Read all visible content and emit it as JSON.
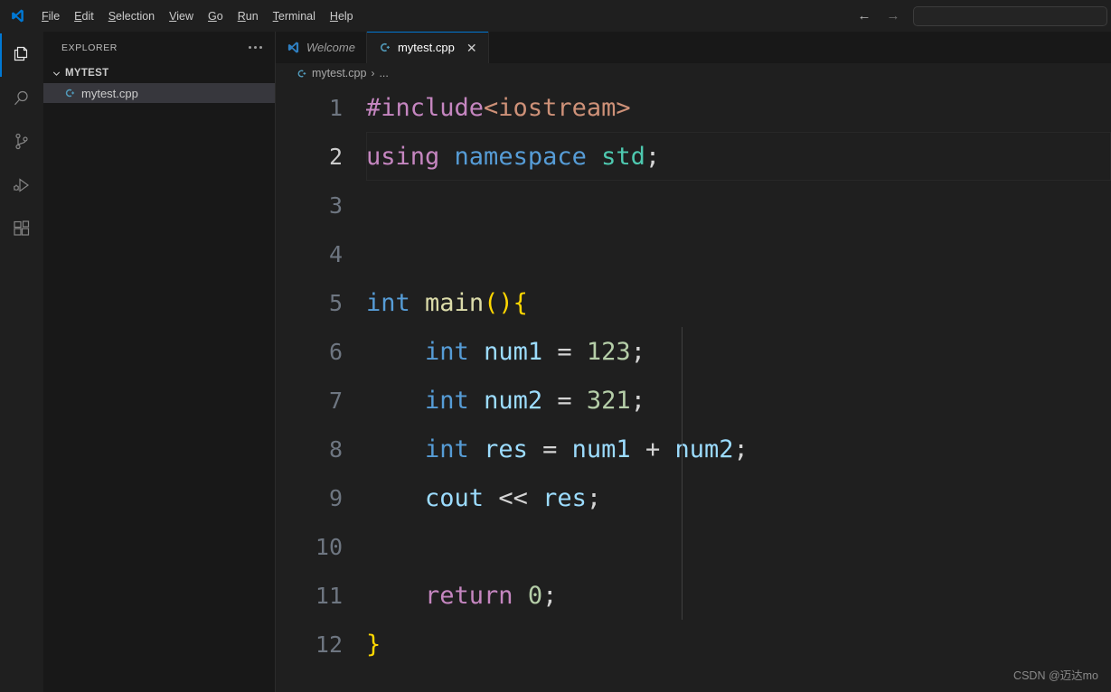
{
  "titlebar": {
    "logo_icon": "vscode-logo-icon",
    "menus": [
      {
        "label": "File",
        "mnemonic": "F"
      },
      {
        "label": "Edit",
        "mnemonic": "E"
      },
      {
        "label": "Selection",
        "mnemonic": "S"
      },
      {
        "label": "View",
        "mnemonic": "V"
      },
      {
        "label": "Go",
        "mnemonic": "G"
      },
      {
        "label": "Run",
        "mnemonic": "R"
      },
      {
        "label": "Terminal",
        "mnemonic": "T"
      },
      {
        "label": "Help",
        "mnemonic": "H"
      }
    ],
    "back_icon": "arrow-left-icon",
    "forward_icon": "arrow-right-icon",
    "back_glyph": "←",
    "forward_glyph": "→",
    "command_center_value": "",
    "command_center_placeholder": ""
  },
  "activitybar": {
    "items": [
      {
        "name": "explorer",
        "icon": "files-icon",
        "active": true
      },
      {
        "name": "search",
        "icon": "search-icon",
        "active": false
      },
      {
        "name": "source-control",
        "icon": "branch-icon",
        "active": false
      },
      {
        "name": "run-debug",
        "icon": "run-debug-icon",
        "active": false
      },
      {
        "name": "extensions",
        "icon": "extensions-icon",
        "active": false
      }
    ]
  },
  "sidebar": {
    "title": "EXPLORER",
    "more_actions_icon": "ellipsis-icon",
    "folder": {
      "name": "MYTEST",
      "expanded": true,
      "chevron_icon": "chevron-down-icon"
    },
    "files": [
      {
        "name": "mytest.cpp",
        "icon": "cpp-file-icon",
        "selected": true
      }
    ]
  },
  "tabs": [
    {
      "label": "Welcome",
      "icon": "vscode-logo-icon",
      "active": false,
      "italic": true,
      "closable": false
    },
    {
      "label": "mytest.cpp",
      "icon": "cpp-file-icon",
      "active": true,
      "italic": false,
      "closable": true,
      "close_glyph": "✕"
    }
  ],
  "breadcrumb": {
    "icon": "cpp-file-icon",
    "file": "mytest.cpp",
    "separator": "›",
    "overflow": "..."
  },
  "editor": {
    "active_line": 2,
    "lines": [
      {
        "n": "1",
        "tokens": [
          {
            "t": "#include",
            "c": "t-kw-pink"
          },
          {
            "t": "<iostream>",
            "c": "t-str"
          }
        ]
      },
      {
        "n": "2",
        "tokens": [
          {
            "t": "using",
            "c": "t-kw-pink"
          },
          {
            "t": " ",
            "c": "t-plain"
          },
          {
            "t": "namespace",
            "c": "t-key"
          },
          {
            "t": " ",
            "c": "t-plain"
          },
          {
            "t": "std",
            "c": "t-type"
          },
          {
            "t": ";",
            "c": "t-op"
          }
        ]
      },
      {
        "n": "3",
        "tokens": []
      },
      {
        "n": "4",
        "tokens": []
      },
      {
        "n": "5",
        "tokens": [
          {
            "t": "int",
            "c": "t-key"
          },
          {
            "t": " ",
            "c": "t-plain"
          },
          {
            "t": "main",
            "c": "t-fn"
          },
          {
            "t": "()",
            "c": "t-br1"
          },
          {
            "t": "{",
            "c": "t-br1"
          }
        ]
      },
      {
        "n": "6",
        "tokens": [
          {
            "t": "    ",
            "c": "t-plain"
          },
          {
            "t": "int",
            "c": "t-key"
          },
          {
            "t": " ",
            "c": "t-plain"
          },
          {
            "t": "num1",
            "c": "t-var"
          },
          {
            "t": " ",
            "c": "t-plain"
          },
          {
            "t": "=",
            "c": "t-op"
          },
          {
            "t": " ",
            "c": "t-plain"
          },
          {
            "t": "123",
            "c": "t-num"
          },
          {
            "t": ";",
            "c": "t-op"
          }
        ]
      },
      {
        "n": "7",
        "tokens": [
          {
            "t": "    ",
            "c": "t-plain"
          },
          {
            "t": "int",
            "c": "t-key"
          },
          {
            "t": " ",
            "c": "t-plain"
          },
          {
            "t": "num2",
            "c": "t-var"
          },
          {
            "t": " ",
            "c": "t-plain"
          },
          {
            "t": "=",
            "c": "t-op"
          },
          {
            "t": " ",
            "c": "t-plain"
          },
          {
            "t": "321",
            "c": "t-num"
          },
          {
            "t": ";",
            "c": "t-op"
          }
        ]
      },
      {
        "n": "8",
        "tokens": [
          {
            "t": "    ",
            "c": "t-plain"
          },
          {
            "t": "int",
            "c": "t-key"
          },
          {
            "t": " ",
            "c": "t-plain"
          },
          {
            "t": "res",
            "c": "t-var"
          },
          {
            "t": " ",
            "c": "t-plain"
          },
          {
            "t": "=",
            "c": "t-op"
          },
          {
            "t": " ",
            "c": "t-plain"
          },
          {
            "t": "num1",
            "c": "t-var"
          },
          {
            "t": " ",
            "c": "t-plain"
          },
          {
            "t": "+",
            "c": "t-op"
          },
          {
            "t": " ",
            "c": "t-plain"
          },
          {
            "t": "num2",
            "c": "t-var"
          },
          {
            "t": ";",
            "c": "t-op"
          }
        ]
      },
      {
        "n": "9",
        "tokens": [
          {
            "t": "    ",
            "c": "t-plain"
          },
          {
            "t": "cout",
            "c": "t-var"
          },
          {
            "t": " ",
            "c": "t-plain"
          },
          {
            "t": "<<",
            "c": "t-op"
          },
          {
            "t": " ",
            "c": "t-plain"
          },
          {
            "t": "res",
            "c": "t-var"
          },
          {
            "t": ";",
            "c": "t-op"
          }
        ]
      },
      {
        "n": "10",
        "tokens": []
      },
      {
        "n": "11",
        "tokens": [
          {
            "t": "    ",
            "c": "t-plain"
          },
          {
            "t": "return",
            "c": "t-kw-pink"
          },
          {
            "t": " ",
            "c": "t-plain"
          },
          {
            "t": "0",
            "c": "t-num"
          },
          {
            "t": ";",
            "c": "t-op"
          }
        ]
      },
      {
        "n": "12",
        "tokens": [
          {
            "t": "}",
            "c": "t-br1"
          }
        ]
      }
    ]
  },
  "watermark": "CSDN @迈达mo",
  "colors": {
    "accent": "#0078d4",
    "editor_bg": "#1f1f1f",
    "sidebar_bg": "#181818",
    "selection_bg": "#37373d",
    "keyword_blue": "#569cd6",
    "keyword_pink": "#c586c0",
    "string_orange": "#ce9178",
    "type_green": "#4ec9b0",
    "function_yellow": "#dcdcaa",
    "variable_lightblue": "#9cdcfe",
    "number_green": "#b5cea8",
    "bracket_gold": "#ffd700"
  }
}
